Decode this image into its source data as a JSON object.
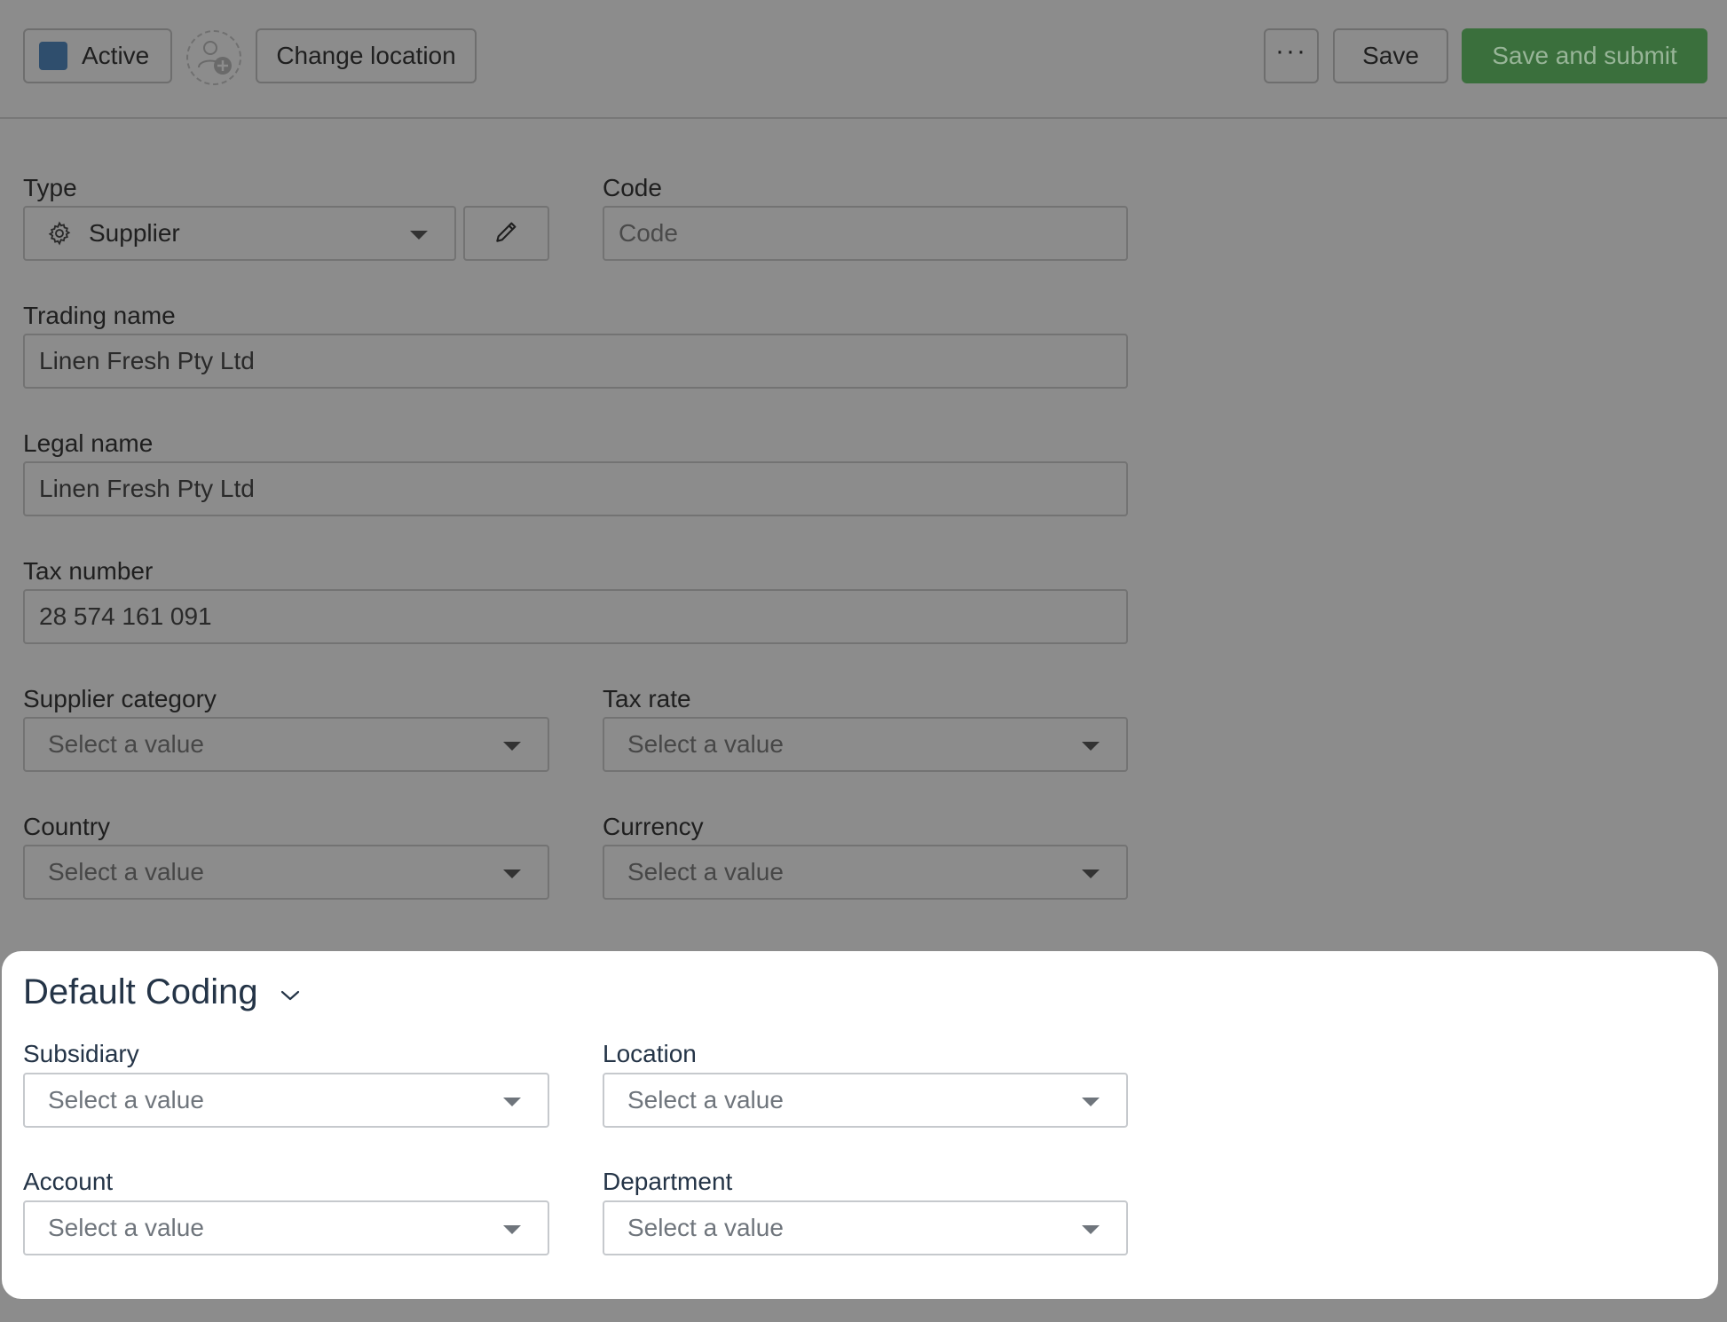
{
  "toolbar": {
    "status_label": "Active",
    "status_color": "#2f4e6d",
    "change_location_label": "Change location",
    "more_label": "···",
    "save_label": "Save",
    "save_submit_label": "Save and submit",
    "save_submit_color": "#3a6f3c"
  },
  "form": {
    "type": {
      "label": "Type",
      "value": "Supplier",
      "icon": "gear-icon",
      "edit_icon": "pencil-icon"
    },
    "code": {
      "label": "Code",
      "placeholder": "Code"
    },
    "trading_name": {
      "label": "Trading name",
      "value": "Linen Fresh Pty Ltd"
    },
    "legal_name": {
      "label": "Legal name",
      "value": "Linen Fresh Pty Ltd"
    },
    "tax_number": {
      "label": "Tax number",
      "value": "28 574 161 091"
    },
    "supplier_category": {
      "label": "Supplier category",
      "placeholder": "Select a value"
    },
    "tax_rate": {
      "label": "Tax rate",
      "placeholder": "Select a value"
    },
    "country": {
      "label": "Country",
      "placeholder": "Select a value"
    },
    "currency": {
      "label": "Currency",
      "placeholder": "Select a value"
    }
  },
  "default_coding": {
    "title": "Default Coding",
    "subsidiary": {
      "label": "Subsidiary",
      "placeholder": "Select a value"
    },
    "location": {
      "label": "Location",
      "placeholder": "Select a value"
    },
    "account": {
      "label": "Account",
      "placeholder": "Select a value"
    },
    "department": {
      "label": "Department",
      "placeholder": "Select a value"
    }
  }
}
